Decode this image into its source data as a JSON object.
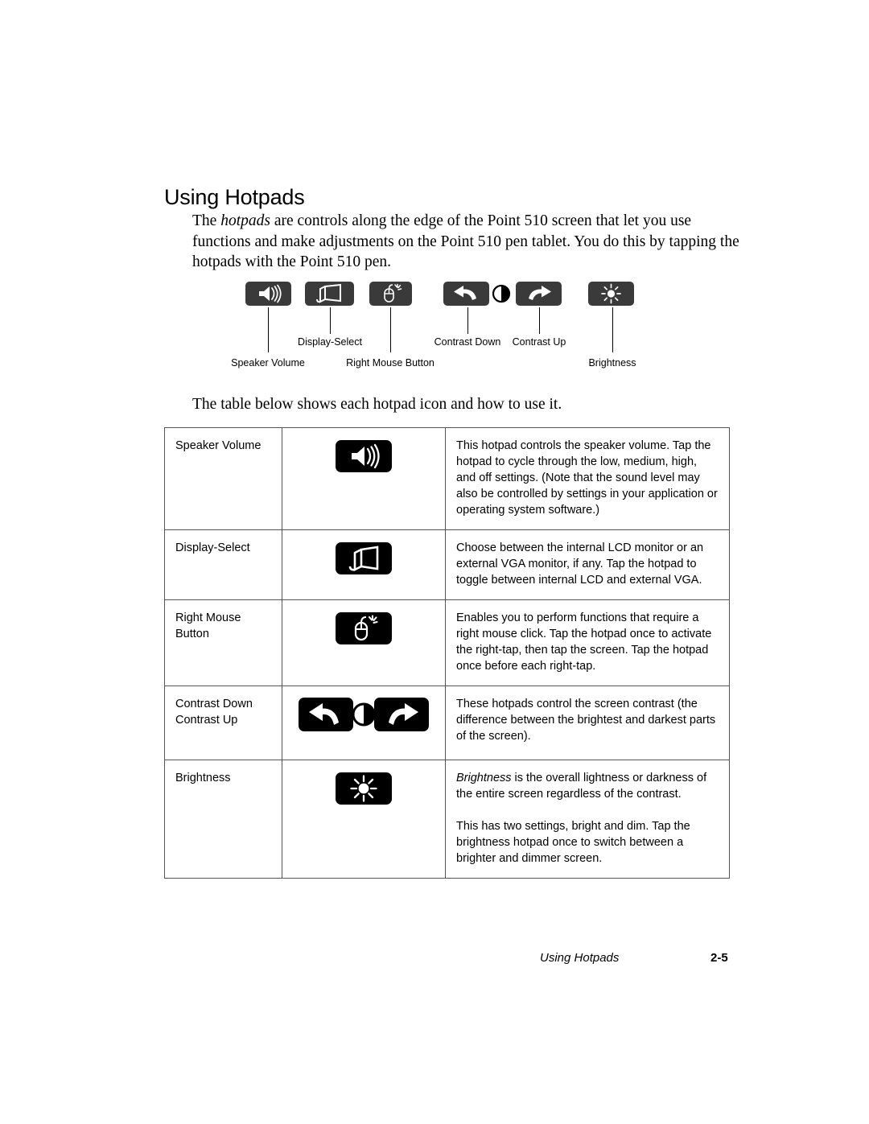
{
  "document": {
    "title": "Using Hotpads",
    "intro_paragraph_pre": "The ",
    "intro_paragraph_em": "hotpads",
    "intro_paragraph_post": " are controls along the edge of the Point 510 screen that let you use functions and make adjustments on the Point 510 pen tablet. You do this by tapping the hotpads with the Point 510 pen.",
    "table_intro": "The table below shows each hotpad icon and how to use it."
  },
  "diagram": {
    "pad_color": "#3a3a3a",
    "labels": [
      {
        "id": "speaker-volume",
        "text": "Speaker Volume",
        "icon": "speaker-icon"
      },
      {
        "id": "display-select",
        "text": "Display-Select",
        "icon": "monitor-icon"
      },
      {
        "id": "right-mouse",
        "text": "Right Mouse Button",
        "icon": "mouse-click-icon"
      },
      {
        "id": "contrast-down",
        "text": "Contrast Down",
        "icon": "arrow-curve-up-left-icon"
      },
      {
        "id": "contrast-up",
        "text": "Contrast Up",
        "icon": "arrow-curve-up-right-icon"
      },
      {
        "id": "brightness",
        "text": "Brightness",
        "icon": "sun-icon"
      }
    ],
    "contrast_globe_icon": "half-filled-circle-icon"
  },
  "table": {
    "icon_color": "#000000",
    "rows": [
      {
        "name": "Speaker Volume",
        "icon": "speaker-icon",
        "description": "This hotpad controls the speaker volume. Tap the hotpad to cycle through the low, medium, high, and off settings. (Note that the sound level may also be controlled by settings in your application or operating system software.)"
      },
      {
        "name": "Display-Select",
        "icon": "monitor-icon",
        "description": "Choose between the internal LCD monitor or an external VGA monitor, if any. Tap the hotpad to toggle between internal LCD and external VGA."
      },
      {
        "name": "Right Mouse\nButton",
        "name_line1": "Right Mouse",
        "name_line2": "Button",
        "icon": "mouse-click-icon",
        "description": "Enables you to perform functions that require a right mouse click. Tap the hotpad once to activate the right-tap, then tap the screen. Tap the hotpad once before each right-tap."
      },
      {
        "name_line1": "Contrast Down",
        "name_line2": "Contrast Up",
        "icon": "contrast-pair-icon",
        "description": "These hotpads control the screen contrast (the difference between the brightest and darkest parts of the screen)."
      },
      {
        "name": "Brightness",
        "icon": "sun-icon",
        "description_em": "Brightness",
        "description_p1_rest": " is the overall lightness or darkness of the entire screen regardless of the contrast.",
        "description_p2": "This has two settings, bright and dim. Tap the brightness hotpad once to switch between a brighter and dimmer screen."
      }
    ]
  },
  "footer": {
    "title": "Using Hotpads",
    "page_number": "2-5"
  }
}
